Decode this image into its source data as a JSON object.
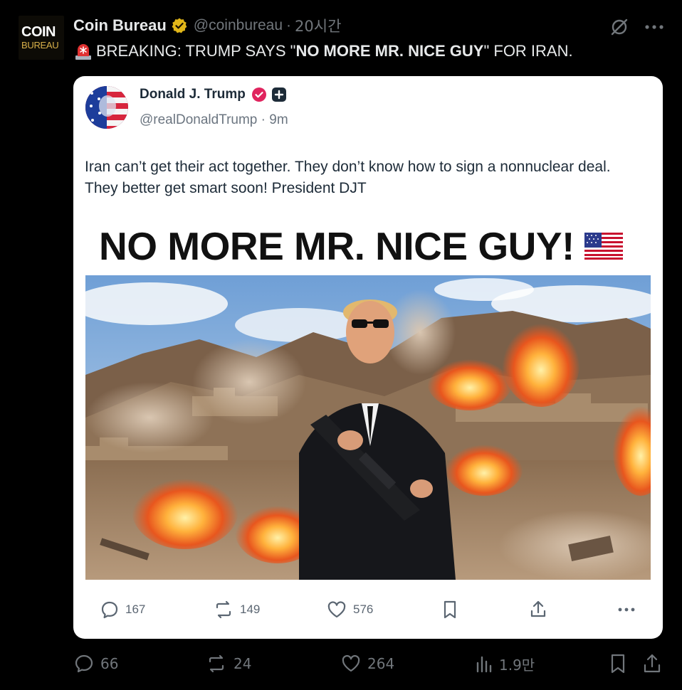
{
  "tweet": {
    "author_name": "Coin Bureau",
    "handle": "@coinbureau",
    "separator": "·",
    "time": "20시간",
    "avatar": {
      "line1": "COIN",
      "line2": "BUREAU"
    },
    "text_prefix": "BREAKING: TRUMP SAYS \"",
    "text_bold": "NO MORE MR. NICE GUY",
    "text_suffix": "\" FOR IRAN."
  },
  "quoted": {
    "author_name": "Donald J. Trump",
    "handle_time": "@realDonaldTrump · 9m",
    "text": "Iran can’t get their act together. They don’t know how to sign a nonnuclear deal. They better get smart soon! President DJT",
    "headline": "NO MORE MR. NICE GUY!",
    "actions": {
      "replies": "167",
      "reposts": "149",
      "likes": "576"
    }
  },
  "actions": {
    "replies": "66",
    "reposts": "24",
    "likes": "264",
    "views": "1.9만"
  },
  "colors": {
    "background": "#000000",
    "text": "#e7e9ea",
    "muted": "#71767b",
    "verified_gold": "#e2b719",
    "verified_pink": "#e0245e"
  }
}
